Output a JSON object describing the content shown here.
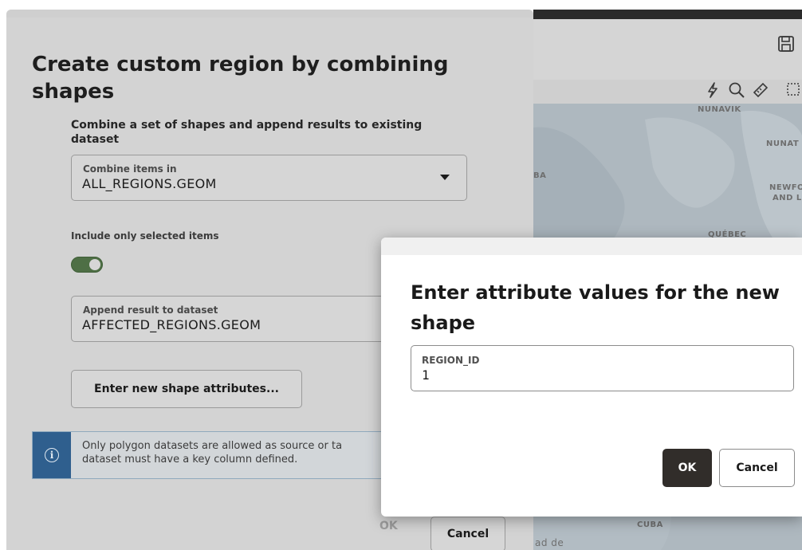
{
  "map": {
    "labels": {
      "nunavik": "NUNAVIK",
      "nunat": "NUNAT",
      "ba": "BA",
      "newf": "NEWFO",
      "andl": "AND L",
      "quebec": "QUÉBEC",
      "cuba": "CUBA",
      "madde": "ad de"
    }
  },
  "main_dialog": {
    "title": "Create custom region by combining shapes",
    "subtitle": "Combine a set of shapes and append results to existing dataset",
    "combine_field": {
      "label": "Combine items in",
      "value": "ALL_REGIONS.GEOM"
    },
    "include_selected_label": "Include only selected items",
    "include_selected_on": true,
    "append_field": {
      "label": "Append result to dataset",
      "value": "AFFECTED_REGIONS.GEOM"
    },
    "enter_attributes_button": "Enter new shape attributes...",
    "info_message_line1": "Only polygon datasets are allowed as source or ta",
    "info_message_line2": "dataset must have a key column defined.",
    "ok_label": "OK",
    "cancel_label": "Cancel"
  },
  "attribute_dialog": {
    "title": "Enter attribute values for the new shape",
    "field_label": "REGION_ID",
    "field_value": "1",
    "ok_label": "OK",
    "cancel_label": "Cancel"
  },
  "colors": {
    "toggle_on": "#4e6f45",
    "info_accent": "#2f5f8e",
    "primary_button": "#312d2a"
  }
}
